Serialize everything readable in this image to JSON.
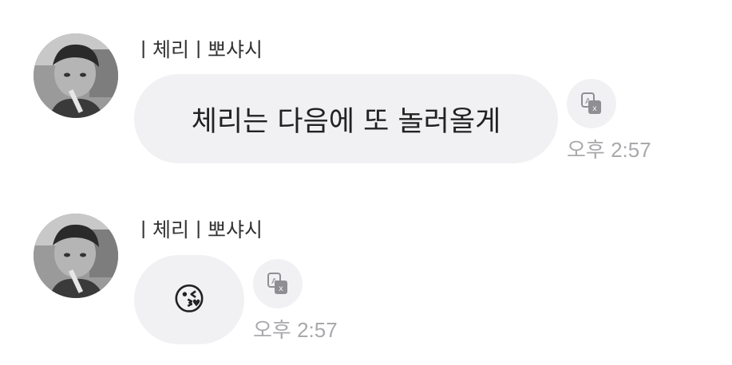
{
  "messages": [
    {
      "sender": "ㅣ체리ㅣ뽀샤시",
      "text": "체리는 다음에 또 놀러올게",
      "time": "오후 2:57",
      "avatar_icon": "profile-photo",
      "translate_icon": "translate-icon"
    },
    {
      "sender": "ㅣ체리ㅣ뽀샤시",
      "text": "😘",
      "time": "오후 2:57",
      "avatar_icon": "profile-photo",
      "translate_icon": "translate-icon"
    }
  ],
  "colors": {
    "bubble": "#f1f1f3",
    "time": "#a9a9ad",
    "sender": "#333333",
    "message_text": "#222222",
    "translate_icon": "#8e8e93"
  }
}
